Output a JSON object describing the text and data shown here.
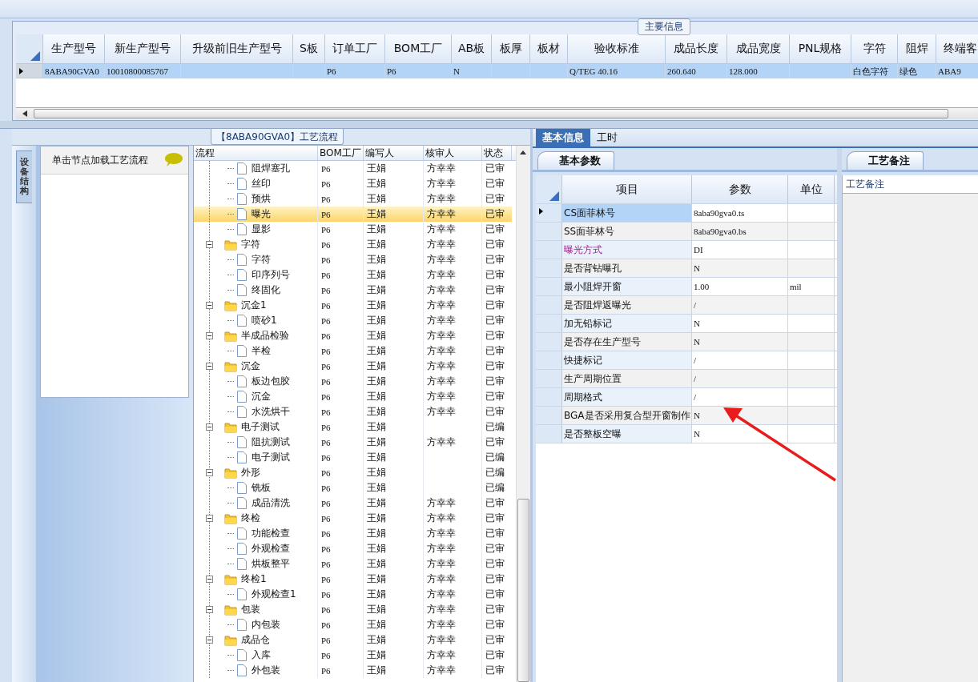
{
  "main_info": {
    "title": "主要信息",
    "row_selected": true,
    "columns": [
      {
        "label": "生产型号",
        "value": "8ABA90GVA0"
      },
      {
        "label": "新生产型号",
        "value": "10010800085767"
      },
      {
        "label": "升级前旧生产型号"
      },
      {
        "label": "S板"
      },
      {
        "label": "订单工厂",
        "value": "P6"
      },
      {
        "label": "BOM工厂",
        "value": "P6"
      },
      {
        "label": "AB板",
        "value": "N"
      },
      {
        "label": "板厚"
      },
      {
        "label": "板材"
      },
      {
        "label": "验收标准",
        "value": "Q/TEG 40.16"
      },
      {
        "label": "成品长度",
        "value": "260.640"
      },
      {
        "label": "成品宽度",
        "value": "128.000"
      },
      {
        "label": "PNL规格"
      },
      {
        "label": "字符",
        "value": "白色字符"
      },
      {
        "label": "阻焊",
        "value": "绿色"
      },
      {
        "label": "终端客",
        "value": "ABA9"
      }
    ]
  },
  "process_panel": {
    "title": "【8ABA90GVA0】工艺流程",
    "side_tab": "设备结构",
    "nav_hint": "单击节点加载工艺流程",
    "columns": [
      "流程",
      "BOM工厂",
      "编写人",
      "核审人",
      "状态"
    ],
    "tree": [
      {
        "kind": "hidden",
        "children": [
          {
            "kind": "step",
            "label": "阻焊塞孔",
            "bom": "P6",
            "writer": "王娟",
            "reviewer": "方幸幸",
            "status": "已审",
            "selected": false
          },
          {
            "kind": "step",
            "label": "丝印",
            "bom": "P6",
            "writer": "王娟",
            "reviewer": "方幸幸",
            "status": "已审",
            "selected": false
          },
          {
            "kind": "step",
            "label": "预烘",
            "bom": "P6",
            "writer": "王娟",
            "reviewer": "方幸幸",
            "status": "已审",
            "selected": false
          },
          {
            "kind": "step",
            "label": "曝光",
            "bom": "P6",
            "writer": "王娟",
            "reviewer": "方幸幸",
            "status": "已审",
            "selected": true
          },
          {
            "kind": "step",
            "label": "显影",
            "bom": "P6",
            "writer": "王娟",
            "reviewer": "方幸幸",
            "status": "已审",
            "selected": false
          }
        ]
      },
      {
        "kind": "folder",
        "label": "字符",
        "bom": "P6",
        "writer": "王娟",
        "reviewer": "方幸幸",
        "status": "已审",
        "selected": false,
        "expanded": true,
        "children": [
          {
            "kind": "step",
            "label": "字符",
            "bom": "P6",
            "writer": "王娟",
            "reviewer": "方幸幸",
            "status": "已审",
            "selected": false
          },
          {
            "kind": "step",
            "label": "印序列号",
            "bom": "P6",
            "writer": "王娟",
            "reviewer": "方幸幸",
            "status": "已审",
            "selected": false
          },
          {
            "kind": "step",
            "label": "终固化",
            "bom": "P6",
            "writer": "王娟",
            "reviewer": "方幸幸",
            "status": "已审",
            "selected": false
          }
        ]
      },
      {
        "kind": "folder",
        "label": "沉金1",
        "bom": "P6",
        "writer": "王娟",
        "reviewer": "方幸幸",
        "status": "已审",
        "selected": false,
        "expanded": true,
        "children": [
          {
            "kind": "step",
            "label": "喷砂1",
            "bom": "P6",
            "writer": "王娟",
            "reviewer": "方幸幸",
            "status": "已审",
            "selected": false
          }
        ]
      },
      {
        "kind": "folder",
        "label": "半成品检验",
        "bom": "P6",
        "writer": "王娟",
        "reviewer": "方幸幸",
        "status": "已审",
        "selected": false,
        "expanded": true,
        "children": [
          {
            "kind": "step",
            "label": "半检",
            "bom": "P6",
            "writer": "王娟",
            "reviewer": "方幸幸",
            "status": "已审",
            "selected": false
          }
        ]
      },
      {
        "kind": "folder",
        "label": "沉金",
        "bom": "P6",
        "writer": "王娟",
        "reviewer": "方幸幸",
        "status": "已审",
        "selected": false,
        "expanded": true,
        "children": [
          {
            "kind": "step",
            "label": "板边包胶",
            "bom": "P6",
            "writer": "王娟",
            "reviewer": "方幸幸",
            "status": "已审",
            "selected": false
          },
          {
            "kind": "step",
            "label": "沉金",
            "bom": "P6",
            "writer": "王娟",
            "reviewer": "方幸幸",
            "status": "已审",
            "selected": false
          },
          {
            "kind": "step",
            "label": "水洗烘干",
            "bom": "P6",
            "writer": "王娟",
            "reviewer": "方幸幸",
            "status": "已审",
            "selected": false
          }
        ]
      },
      {
        "kind": "folder",
        "label": "电子测试",
        "bom": "P6",
        "writer": "王娟",
        "status": "已编",
        "selected": false,
        "expanded": true,
        "children": [
          {
            "kind": "step",
            "label": "阻抗测试",
            "bom": "P6",
            "writer": "王娟",
            "reviewer": "方幸幸",
            "status": "已审",
            "selected": false
          },
          {
            "kind": "step",
            "label": "电子测试",
            "bom": "P6",
            "writer": "王娟",
            "status": "已编",
            "selected": false
          }
        ]
      },
      {
        "kind": "folder",
        "label": "外形",
        "bom": "P6",
        "writer": "王娟",
        "status": "已编",
        "selected": false,
        "expanded": true,
        "children": [
          {
            "kind": "step",
            "label": "铣板",
            "bom": "P6",
            "writer": "王娟",
            "status": "已编",
            "selected": false
          },
          {
            "kind": "step",
            "label": "成品清洗",
            "bom": "P6",
            "writer": "王娟",
            "reviewer": "方幸幸",
            "status": "已审",
            "selected": false
          }
        ]
      },
      {
        "kind": "folder",
        "label": "终检",
        "bom": "P6",
        "writer": "王娟",
        "reviewer": "方幸幸",
        "status": "已审",
        "selected": false,
        "expanded": true,
        "children": [
          {
            "kind": "step",
            "label": "功能检查",
            "bom": "P6",
            "writer": "王娟",
            "reviewer": "方幸幸",
            "status": "已审",
            "selected": false
          },
          {
            "kind": "step",
            "label": "外观检查",
            "bom": "P6",
            "writer": "王娟",
            "reviewer": "方幸幸",
            "status": "已审",
            "selected": false
          },
          {
            "kind": "step",
            "label": "烘板整平",
            "bom": "P6",
            "writer": "王娟",
            "reviewer": "方幸幸",
            "status": "已审",
            "selected": false
          }
        ]
      },
      {
        "kind": "folder",
        "label": "终检1",
        "bom": "P6",
        "writer": "王娟",
        "reviewer": "方幸幸",
        "status": "已审",
        "selected": false,
        "expanded": true,
        "children": [
          {
            "kind": "step",
            "label": "外观检查1",
            "bom": "P6",
            "writer": "王娟",
            "reviewer": "方幸幸",
            "status": "已审",
            "selected": false
          }
        ]
      },
      {
        "kind": "folder",
        "label": "包装",
        "bom": "P6",
        "writer": "王娟",
        "reviewer": "方幸幸",
        "status": "已审",
        "selected": false,
        "expanded": true,
        "children": [
          {
            "kind": "step",
            "label": "内包装",
            "bom": "P6",
            "writer": "王娟",
            "reviewer": "方幸幸",
            "status": "已审",
            "selected": false
          }
        ]
      },
      {
        "kind": "folder",
        "label": "成品仓",
        "bom": "P6",
        "writer": "王娟",
        "reviewer": "方幸幸",
        "status": "已审",
        "selected": false,
        "expanded": true,
        "children": [
          {
            "kind": "step",
            "label": "入库",
            "bom": "P6",
            "writer": "王娟",
            "reviewer": "方幸幸",
            "status": "已审",
            "selected": false
          },
          {
            "kind": "step",
            "label": "外包装",
            "bom": "P6",
            "writer": "王娟",
            "reviewer": "方幸幸",
            "status": "已审",
            "selected": false
          }
        ]
      }
    ]
  },
  "detail_panel": {
    "tabs": [
      {
        "label": "基本信息",
        "selected": true
      },
      {
        "label": "工时",
        "selected": false
      }
    ],
    "params_tab": "基本参数",
    "columns": [
      "项目",
      "参数",
      "单位"
    ],
    "rows": [
      {
        "item": "CS面菲林号",
        "value": "8aba90gva0.ts",
        "selected": true,
        "emphasized": false
      },
      {
        "item": "SS面菲林号",
        "value": "8aba90gva0.bs",
        "selected": false,
        "emphasized": false
      },
      {
        "item": "曝光方式",
        "value": "DI",
        "selected": false,
        "emphasized": true
      },
      {
        "item": "是否背钻曝孔",
        "value": "N",
        "selected": false,
        "emphasized": false
      },
      {
        "item": "最小阻焊开窗",
        "value": "1.00",
        "unit": "mil",
        "selected": false,
        "emphasized": false
      },
      {
        "item": "是否阻焊返曝光",
        "value": "/",
        "selected": false,
        "emphasized": false
      },
      {
        "item": "加无铅标记",
        "value": "N",
        "selected": false,
        "emphasized": false
      },
      {
        "item": "是否存在生产型号",
        "value": "N",
        "selected": false,
        "emphasized": false
      },
      {
        "item": "快捷标记",
        "value": "/",
        "selected": false,
        "emphasized": false
      },
      {
        "item": "生产周期位置",
        "value": "/",
        "selected": false,
        "emphasized": false
      },
      {
        "item": "周期格式",
        "value": "/",
        "selected": false,
        "emphasized": false
      },
      {
        "item": "BGA是否采用复合型开窗制作",
        "value": "N",
        "selected": false,
        "emphasized": false
      },
      {
        "item": "是否整板空曝",
        "value": "N",
        "selected": false,
        "emphasized": false
      }
    ]
  },
  "notes_panel": {
    "tab": "工艺备注",
    "header": "工艺备注"
  }
}
